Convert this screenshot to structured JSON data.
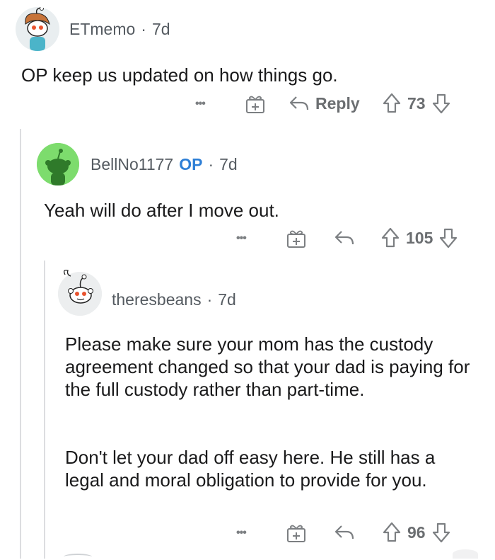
{
  "comments": [
    {
      "username": "ETmemo",
      "time": "7d",
      "text": "OP keep us updated on how things go.",
      "reply_label": "Reply",
      "votes": "73"
    },
    {
      "username": "BellNo1177",
      "op_badge": "OP",
      "time": "7d",
      "text": "Yeah will do after I move out.",
      "votes": "105"
    },
    {
      "username": "theresbeans",
      "time": "7d",
      "paragraphs": [
        "Please make sure your mom has the custody agreement changed so that your dad is paying for the full custody rather than part-time.",
        "Don't let your dad off easy here.  He still has a legal and moral obligation to provide for you."
      ],
      "votes": "96"
    }
  ],
  "more_label": "•••",
  "icons": {
    "more": "more-options-icon",
    "award": "award-gift-icon",
    "reply": "reply-arrow-icon",
    "upvote": "upvote-arrow-icon",
    "downvote": "downvote-arrow-icon"
  },
  "colors": {
    "op": "#2e7fd6",
    "meta": "#555b61",
    "icon": "#7c7f82",
    "avatar_green": "#7ddc6d",
    "thread_line": "#dcdde0"
  }
}
